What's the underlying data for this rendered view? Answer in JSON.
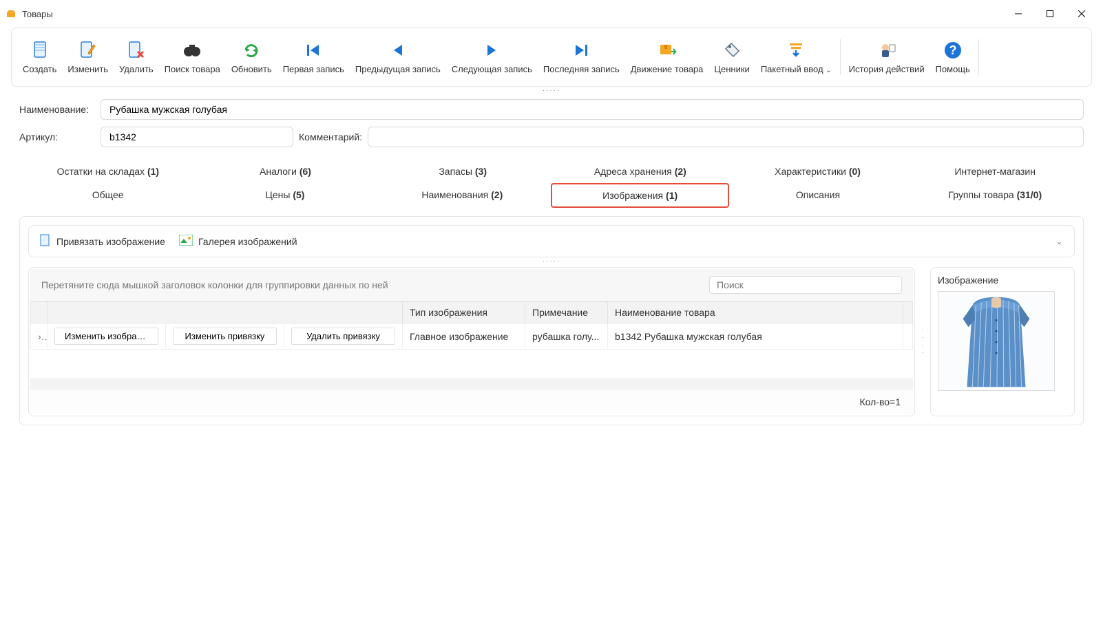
{
  "window": {
    "title": "Товары"
  },
  "toolbar": [
    {
      "key": "create",
      "label": "Создать",
      "icon": "doc-blue"
    },
    {
      "key": "edit",
      "label": "Изменить",
      "icon": "doc-pen"
    },
    {
      "key": "delete",
      "label": "Удалить",
      "icon": "doc-x"
    },
    {
      "key": "search",
      "label": "Поиск товара",
      "icon": "binoculars"
    },
    {
      "key": "refresh",
      "label": "Обновить",
      "icon": "refresh"
    },
    {
      "key": "first",
      "label": "Первая запись",
      "icon": "first"
    },
    {
      "key": "prev",
      "label": "Предыдущая запись",
      "icon": "prev"
    },
    {
      "key": "next",
      "label": "Следующая запись",
      "icon": "next"
    },
    {
      "key": "last",
      "label": "Последняя запись",
      "icon": "last"
    },
    {
      "key": "movement",
      "label": "Движение товара",
      "icon": "box-arrows"
    },
    {
      "key": "pricetags",
      "label": "Ценники",
      "icon": "tag"
    },
    {
      "key": "batch",
      "label": "Пакетный ввод",
      "icon": "batch",
      "dropdown": true
    },
    {
      "key": "history",
      "label": "История действий",
      "icon": "history"
    },
    {
      "key": "help",
      "label": "Помощь",
      "icon": "help"
    }
  ],
  "form": {
    "name_label": "Наименование:",
    "name_value": "Рубашка мужская голубая",
    "article_label": "Артикул:",
    "article_value": "b1342",
    "comment_label": "Комментарий:",
    "comment_value": ""
  },
  "tabs_row1": [
    {
      "key": "stock",
      "label": "Остатки на складах",
      "count": "(1)"
    },
    {
      "key": "analogs",
      "label": "Аналоги",
      "count": "(6)"
    },
    {
      "key": "reserves",
      "label": "Запасы",
      "count": "(3)"
    },
    {
      "key": "storage",
      "label": "Адреса хранения",
      "count": "(2)"
    },
    {
      "key": "chars",
      "label": "Характеристики",
      "count": "(0)"
    },
    {
      "key": "eshop",
      "label": "Интернет-магазин",
      "count": ""
    }
  ],
  "tabs_row2": [
    {
      "key": "general",
      "label": "Общее",
      "count": ""
    },
    {
      "key": "prices",
      "label": "Цены",
      "count": "(5)"
    },
    {
      "key": "names",
      "label": "Наименования",
      "count": "(2)"
    },
    {
      "key": "images",
      "label": "Изображения",
      "count": "(1)",
      "active": true
    },
    {
      "key": "descr",
      "label": "Описания",
      "count": ""
    },
    {
      "key": "groups",
      "label": "Группы товара",
      "count": "(31/0)"
    }
  ],
  "sub_toolbar": {
    "bind": "Привязать изображение",
    "gallery": "Галерея изображений"
  },
  "grid": {
    "group_hint": "Перетяните сюда мышкой заголовок колонки для группировки данных по ней",
    "search_placeholder": "Поиск",
    "columns": {
      "actions_spacer": "",
      "type": "Тип изображения",
      "note": "Примечание",
      "product_name": "Наименование товара"
    },
    "row": {
      "btn_change_image": "Изменить изображение",
      "btn_change_bind": "Изменить привязку",
      "btn_delete_bind": "Удалить привязку",
      "type": "Главное изображение",
      "note": "рубашка голу...",
      "product_name": "b1342 Рубашка мужская голубая"
    },
    "footer": "Кол-во=1"
  },
  "side_panel": {
    "title": "Изображение"
  }
}
